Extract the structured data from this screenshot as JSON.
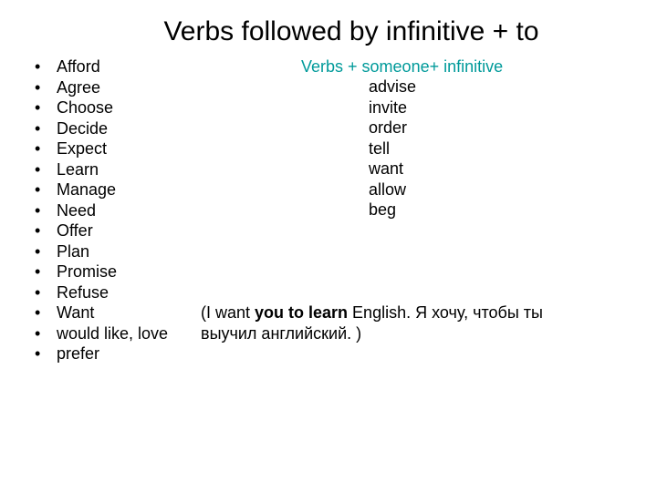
{
  "title": "Verbs followed by infinitive + to",
  "left_verbs": [
    "Afford",
    "Agree",
    "Choose",
    "Decide",
    "Expect",
    "Learn",
    "Manage",
    "Need",
    "Offer",
    "Plan",
    "Promise",
    "Refuse",
    "Want",
    "would like, love",
    " prefer"
  ],
  "bullet_char": "•",
  "right_heading": "Verbs + someone+ infinitive",
  "right_verbs": [
    "advise",
    "invite",
    "order",
    " tell",
    " want",
    " allow",
    " beg"
  ],
  "example": {
    "open": "(I want ",
    "bold1": "you to learn",
    "mid": " English. Я хочу, чтобы ты выучил английский. )"
  }
}
